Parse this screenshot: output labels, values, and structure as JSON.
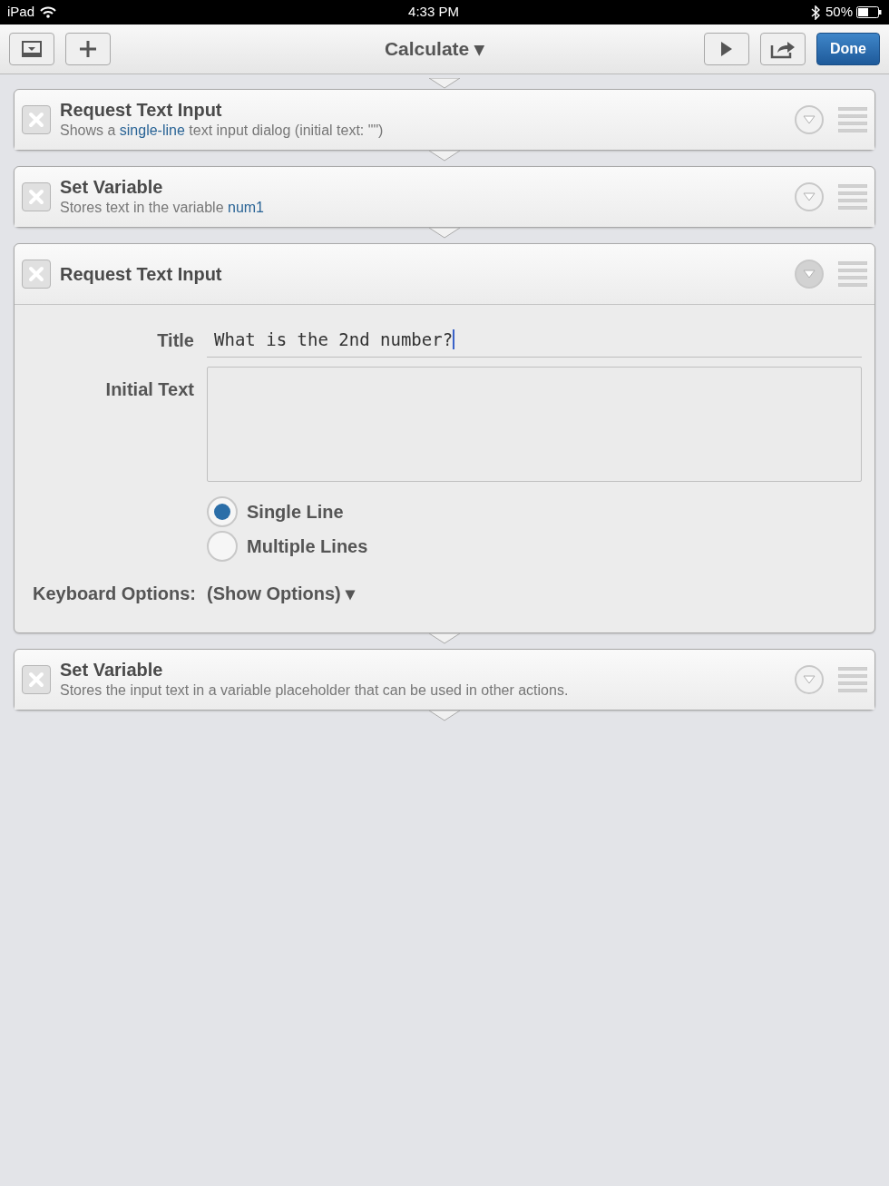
{
  "status_bar": {
    "device": "iPad",
    "time": "4:33 PM",
    "battery": "50%"
  },
  "toolbar": {
    "title": "Calculate ▾",
    "done": "Done"
  },
  "actions": [
    {
      "title": "Request Text Input",
      "expanded": false,
      "description": [
        {
          "text": "Shows a ",
          "highlight": false
        },
        {
          "text": "single-line",
          "highlight": true
        },
        {
          "text": " text input dialog (initial text: \"\")",
          "highlight": false
        }
      ]
    },
    {
      "title": "Set Variable",
      "expanded": false,
      "description": [
        {
          "text": "Stores text in the variable ",
          "highlight": false
        },
        {
          "text": "num1",
          "highlight": true
        }
      ]
    },
    {
      "title": "Request Text Input",
      "expanded": true,
      "fields": {
        "title_label": "Title",
        "title_value": "What is the 2nd number?",
        "initial_label": "Initial Text",
        "options": [
          {
            "label": "Single Line",
            "selected": true
          },
          {
            "label": "Multiple Lines",
            "selected": false
          }
        ],
        "keyboard_label": "Keyboard Options:",
        "keyboard_value": "(Show Options) ▾"
      }
    },
    {
      "title": "Set Variable",
      "expanded": false,
      "description": [
        {
          "text": "Stores the input text in a variable placeholder that can be used in other actions.",
          "highlight": false
        }
      ]
    }
  ]
}
